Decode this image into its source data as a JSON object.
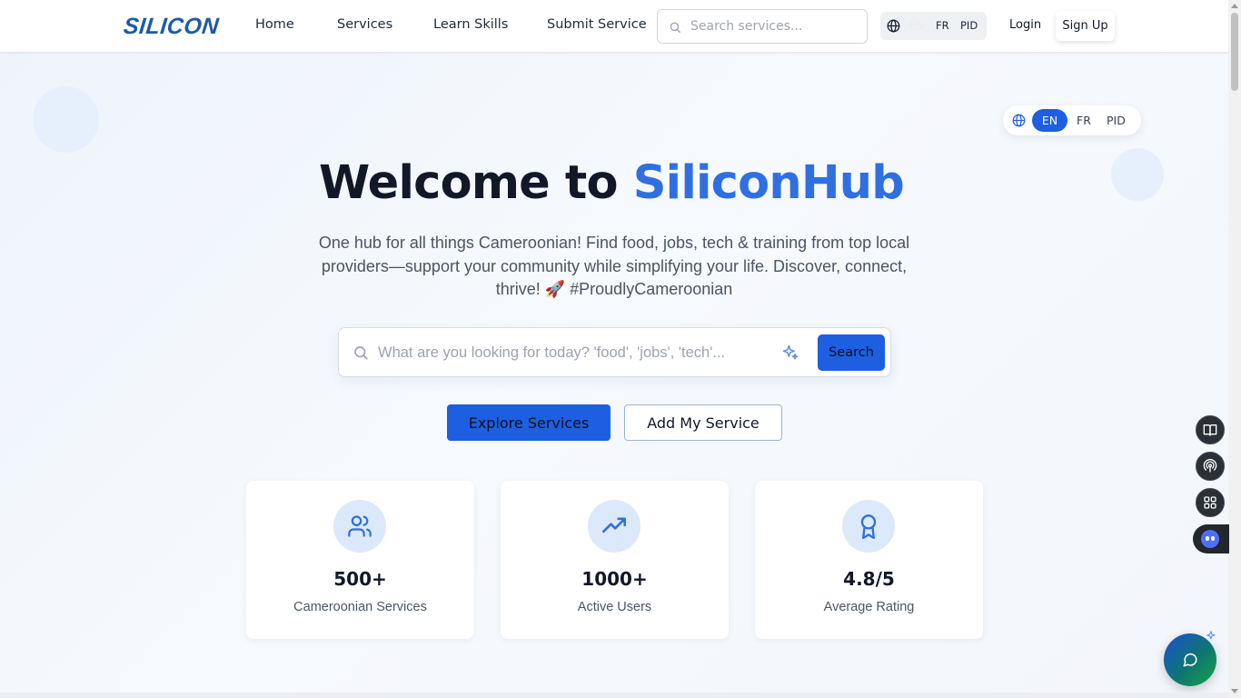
{
  "header": {
    "logo_text": "SILICON",
    "nav": [
      {
        "label": "Home"
      },
      {
        "label": "Services"
      },
      {
        "label": "Learn Skills"
      },
      {
        "label": "Submit Service"
      }
    ],
    "search_placeholder": "Search services...",
    "languages": [
      "EN",
      "FR",
      "PID"
    ],
    "selected_language": "EN",
    "login_label": "Login",
    "signup_label": "Sign Up"
  },
  "language_switcher": {
    "options": [
      "EN",
      "FR",
      "PID"
    ],
    "selected": "EN"
  },
  "hero": {
    "title_prefix": "Welcome to",
    "title_brand": "SiliconHub",
    "subtitle": "One hub for all things Cameroonian! Find food, jobs, tech & training from top local providers—support your community while simplifying your life. Discover, connect, thrive! 🚀 #ProudlyCameroonian",
    "search_placeholder": "What are you looking for today? 'food', 'jobs', 'tech'...",
    "search_button": "Search",
    "primary_cta": "Explore Services",
    "secondary_cta": "Add My Service"
  },
  "stats": [
    {
      "icon": "users-icon",
      "value": "500+",
      "label": "Cameroonian Services"
    },
    {
      "icon": "trending-up-icon",
      "value": "1000+",
      "label": "Active Users"
    },
    {
      "icon": "award-icon",
      "value": "4.8/5",
      "label": "Average Rating"
    }
  ],
  "side_tools": [
    "book-icon",
    "broadcast-icon",
    "apps-icon",
    "assistant-bot-icon"
  ],
  "chat_button_icon": "chat-icon",
  "colors": {
    "brand_blue": "#1d5fe0",
    "logo_blue": "#1e5aa8",
    "title_accent": "#2f6fe0",
    "icon_circle": "#dbe9fb"
  }
}
